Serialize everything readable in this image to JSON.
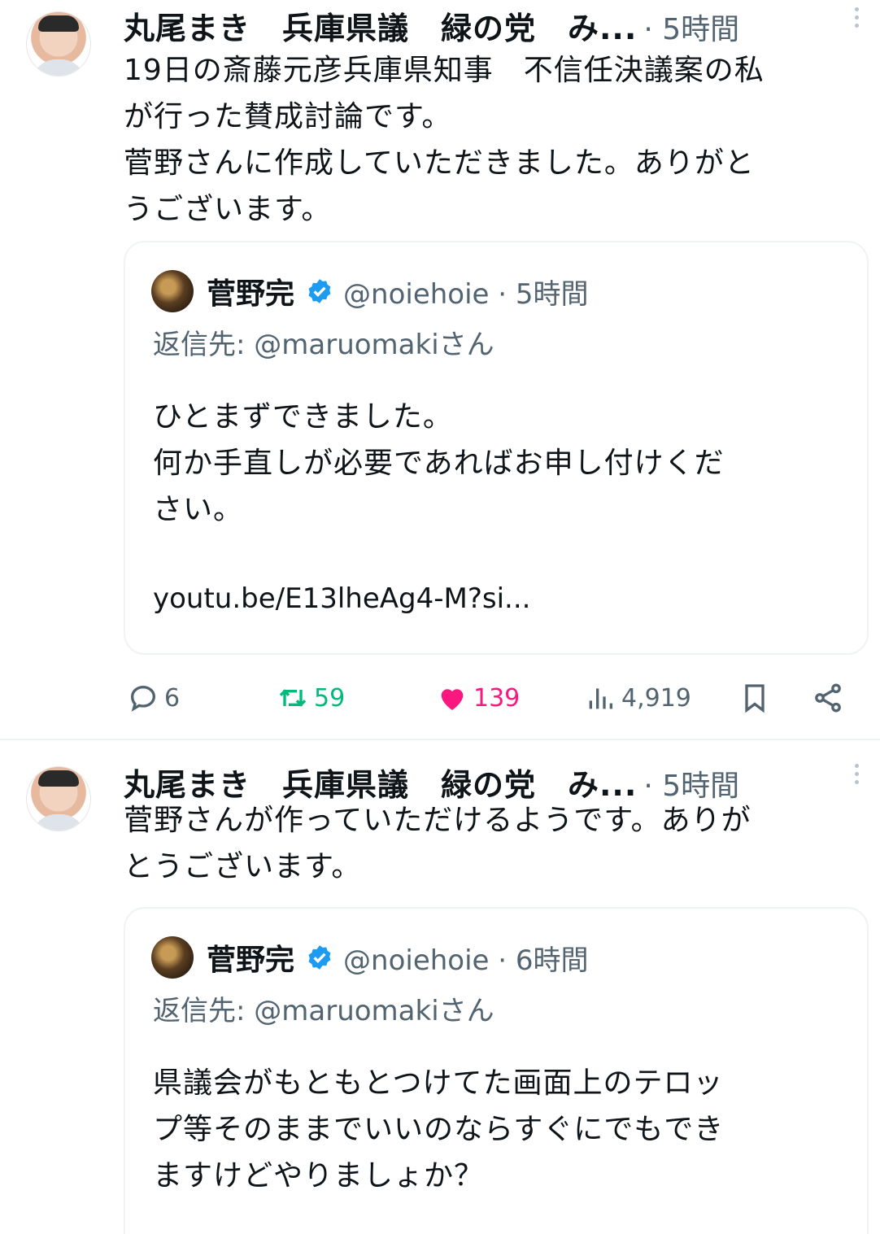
{
  "posts": [
    {
      "author": "丸尾まき　兵庫県議　緑の党　み...",
      "time": "· 5時間",
      "text_lines": [
        "19日の斎藤元彦兵庫県知事　不信任決議案の私",
        "が行った賛成討論です。",
        "菅野さんに作成していただきました。ありがと",
        "うございます。"
      ],
      "quote": {
        "name": "菅野完",
        "handle": "@noiehoie · 5時間",
        "reply_to": "返信先: @maruomakiさん",
        "text_lines": [
          "ひとまずできました。",
          "何か手直しが必要であればお申し付けくだ",
          "さい。"
        ],
        "link": "youtu.be/E13lheAg4-M?si..."
      },
      "actions": {
        "replies": "6",
        "reposts": "59",
        "likes": "139",
        "views": "4,919"
      }
    },
    {
      "author": "丸尾まき　兵庫県議　緑の党　み...",
      "time": "· 5時間",
      "text_lines": [
        "菅野さんが作っていただけるようです。ありが",
        "とうございます。"
      ],
      "quote": {
        "name": "菅野完",
        "handle": "@noiehoie · 6時間",
        "reply_to": "返信先: @maruomakiさん",
        "text_lines": [
          "県議会がもともとつけてた画面上のテロッ",
          "プ等そのままでいいのならすぐにでもでき",
          "ますけどやりましょか？"
        ]
      }
    }
  ],
  "colors": {
    "secondary_text": "#536471",
    "verified_blue": "#1d9bf0",
    "repost_green": "#00ba7c",
    "like_pink": "#f91880"
  }
}
